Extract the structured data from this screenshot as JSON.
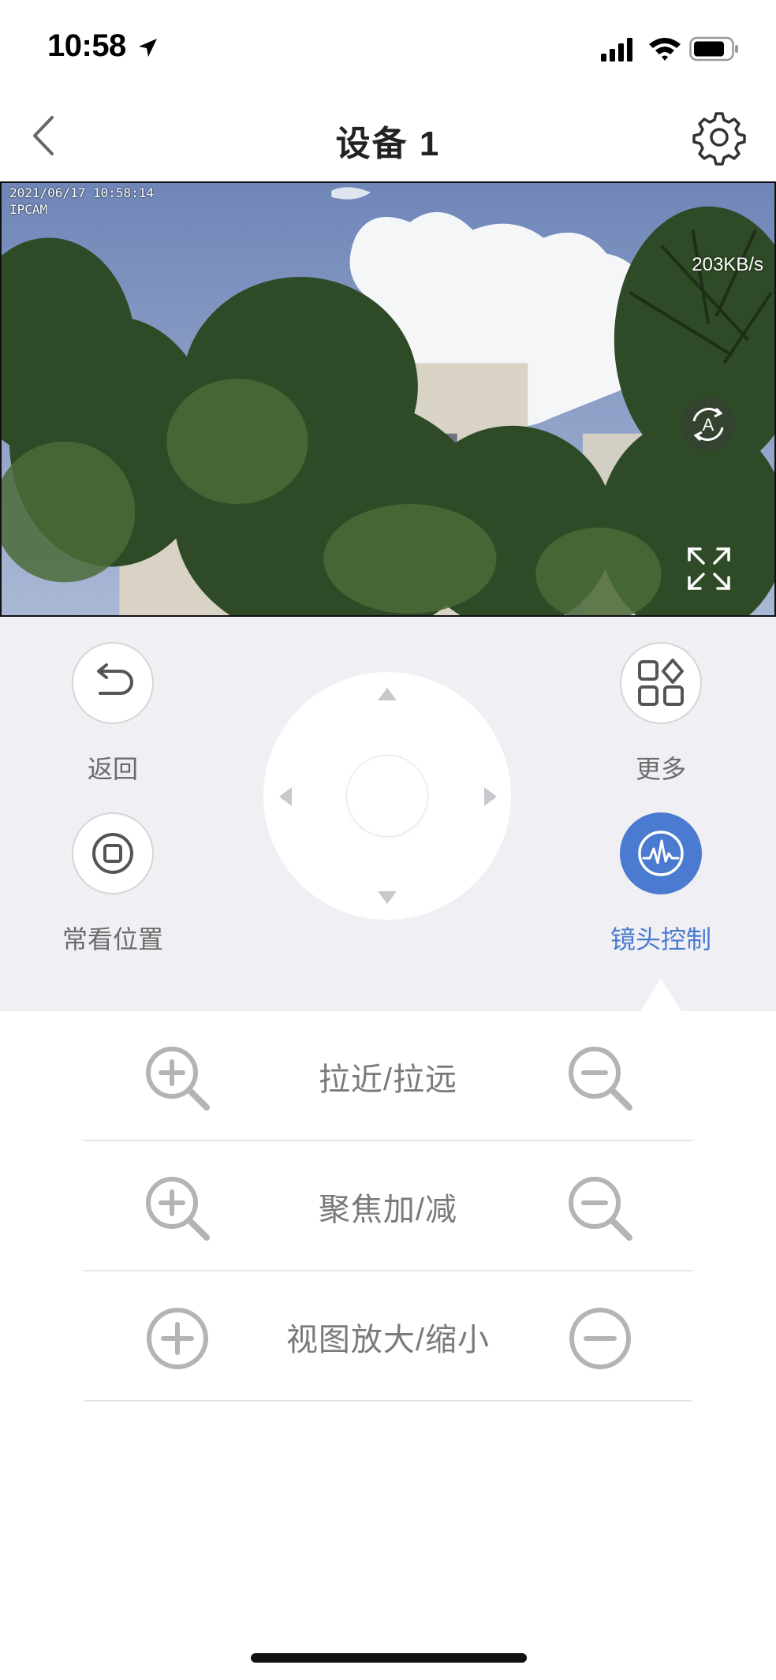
{
  "status_bar": {
    "time": "10:58"
  },
  "nav": {
    "title": "设备 1"
  },
  "video": {
    "timestamp": "2021/06/17 10:58:14",
    "camera_label": "IPCAM",
    "bitrate": "203KB/s"
  },
  "controls": {
    "back_label": "返回",
    "more_label": "更多",
    "preset_label": "常看位置",
    "lens_label": "镜头控制"
  },
  "lens_rows": [
    {
      "label": "拉近/拉远"
    },
    {
      "label": "聚焦加/减"
    },
    {
      "label": "视图放大/缩小"
    }
  ],
  "colors": {
    "accent": "#4a7bd0",
    "panel_bg": "#efeff4",
    "icon_gray": "#b4b4b4"
  },
  "icons": {
    "back": "chevron-left-icon",
    "settings": "gear-icon",
    "auto": "auto-rotate-icon",
    "fullscreen": "fullscreen-icon",
    "undo": "undo-arrow-icon",
    "more": "grid-shapes-icon",
    "preset": "target-square-icon",
    "lens": "waveform-icon",
    "zoom_in": "zoom-in-icon",
    "zoom_out": "zoom-out-icon",
    "plus": "plus-circle-icon",
    "minus": "minus-circle-icon"
  }
}
